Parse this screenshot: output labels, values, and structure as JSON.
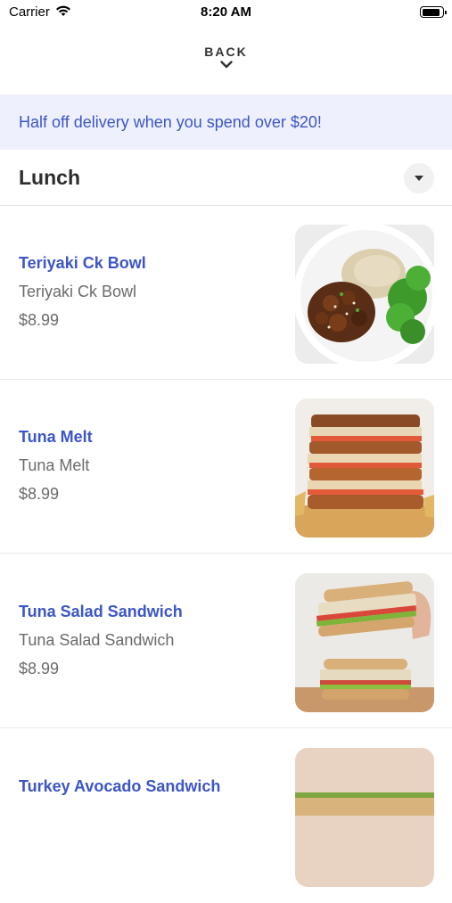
{
  "status": {
    "carrier": "Carrier",
    "time": "8:20 AM"
  },
  "nav": {
    "back_label": "BACK"
  },
  "promo": {
    "text": "Half off delivery when you spend over $20!"
  },
  "section": {
    "title": "Lunch"
  },
  "items": [
    {
      "name": "Teriyaki Ck Bowl",
      "description": "Teriyaki Ck Bowl",
      "price": "$8.99",
      "image": "teriyaki-chicken-bowl-photo"
    },
    {
      "name": "Tuna Melt",
      "description": "Tuna Melt",
      "price": "$8.99",
      "image": "tuna-melt-photo"
    },
    {
      "name": "Tuna Salad Sandwich",
      "description": "Tuna Salad Sandwich",
      "price": "$8.99",
      "image": "tuna-salad-sandwich-photo"
    },
    {
      "name": "Turkey Avocado Sandwich",
      "image": "turkey-avocado-sandwich-photo"
    }
  ],
  "colors": {
    "accent": "#3c55c8",
    "promo_bg": "#eef1fd"
  }
}
